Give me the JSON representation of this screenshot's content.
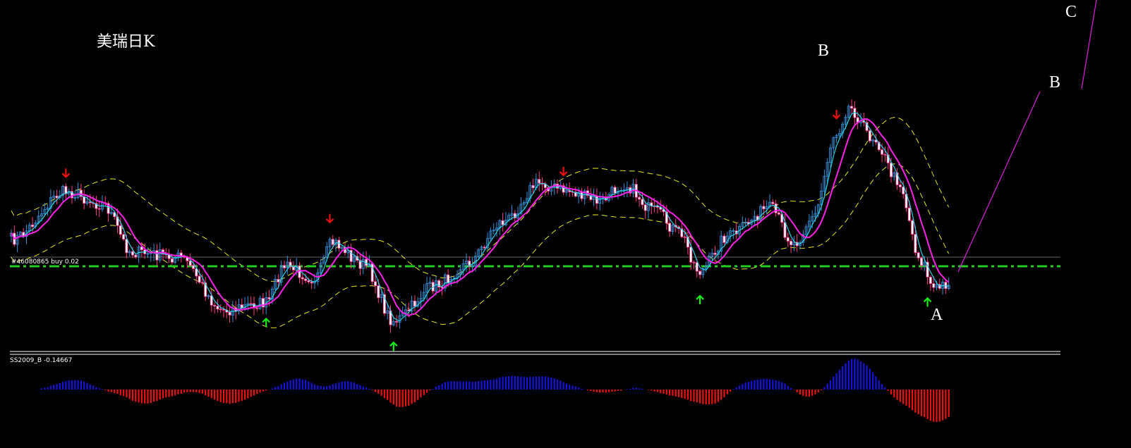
{
  "chart_data": {
    "type": "candlestick",
    "title": "美瑞日K",
    "order_line_label": "#46080865 buy 0.02",
    "indicator_label": "SS2009_B -0.14667",
    "wave_labels": [
      "A",
      "B",
      "B",
      "C"
    ],
    "colors": {
      "background": "#000000",
      "candle_up": "#3a8fd8",
      "candle_down": "#ffffff",
      "candle_down_border": "#ff3b8a",
      "fast_ma": "#2ad1e6",
      "slow_ma": "#ff22e6",
      "envelope": "#e6e62a",
      "order_line": "#22cc22",
      "hist_positive": "#1414dd",
      "hist_negative": "#ee1111",
      "arrow_up": "#18ee18",
      "arrow_down": "#ee1111",
      "projection": "#dd22dd"
    },
    "signals": {
      "down_arrows": [
        18,
        105,
        182,
        272
      ],
      "up_arrows": [
        84,
        126,
        227,
        302
      ]
    }
  }
}
